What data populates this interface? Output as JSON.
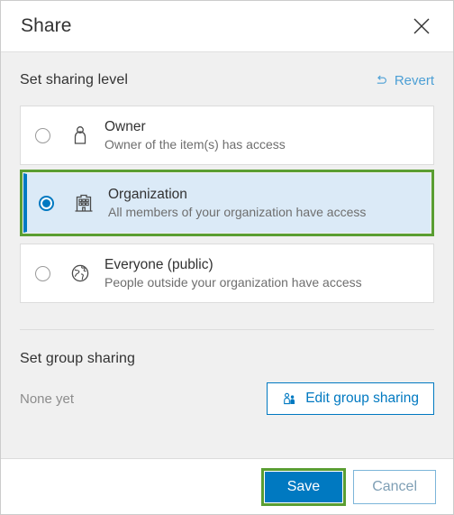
{
  "dialog": {
    "title": "Share",
    "close_icon": "close-icon"
  },
  "sharing_level": {
    "heading": "Set sharing level",
    "revert_label": "Revert",
    "revert_icon": "undo-arrow-icon",
    "options": [
      {
        "id": "owner",
        "title": "Owner",
        "description": "Owner of the item(s) has access",
        "icon": "person-icon",
        "selected": false,
        "highlighted": false
      },
      {
        "id": "organization",
        "title": "Organization",
        "description": "All members of your organization have access",
        "icon": "building-icon",
        "selected": true,
        "highlighted": true
      },
      {
        "id": "everyone",
        "title": "Everyone (public)",
        "description": "People outside your organization have access",
        "icon": "globe-icon",
        "selected": false,
        "highlighted": false
      }
    ]
  },
  "group_sharing": {
    "heading": "Set group sharing",
    "status": "None yet",
    "edit_label": "Edit group sharing",
    "edit_icon": "group-people-icon"
  },
  "footer": {
    "save_label": "Save",
    "cancel_label": "Cancel",
    "save_highlighted": true
  },
  "colors": {
    "accent_blue": "#0079c1",
    "link_blue": "#4c9fd5",
    "highlight_green": "#5a9e32",
    "selected_row_bg": "#dbeaf7",
    "body_bg": "#f0f0f0",
    "title_text": "#323232",
    "desc_text": "#6e6e6e"
  }
}
